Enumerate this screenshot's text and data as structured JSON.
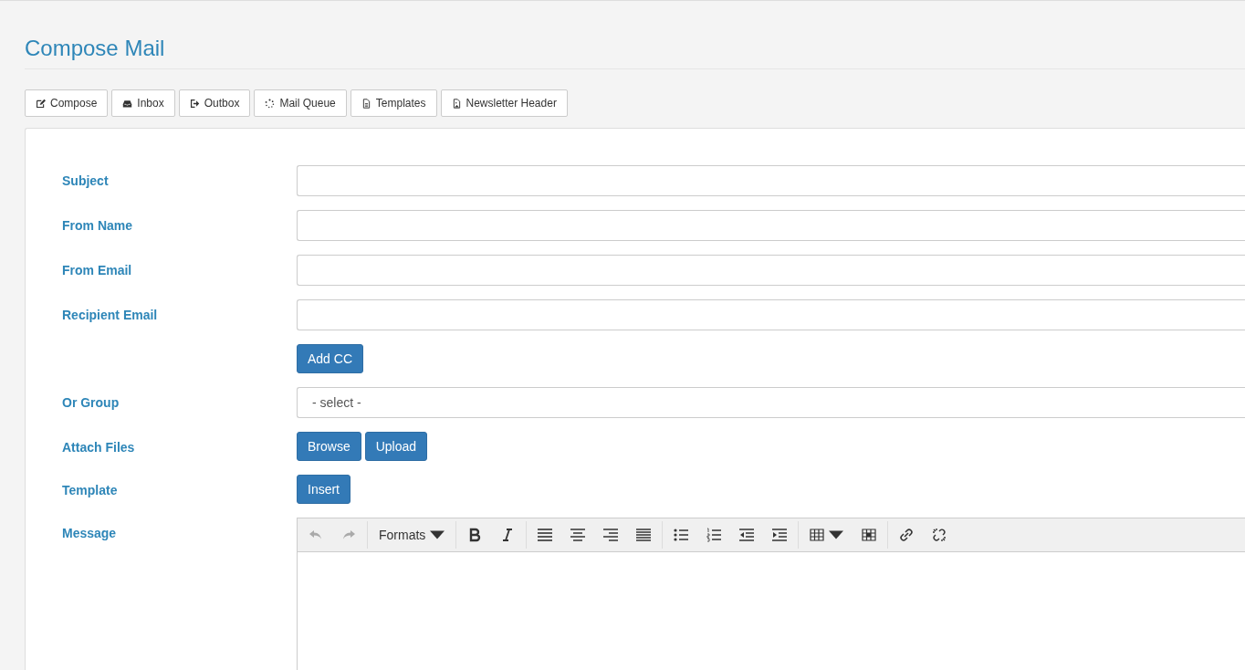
{
  "page_title": "Compose Mail",
  "nav": [
    {
      "label": "Compose"
    },
    {
      "label": "Inbox"
    },
    {
      "label": "Outbox"
    },
    {
      "label": "Mail Queue"
    },
    {
      "label": "Templates"
    },
    {
      "label": "Newsletter Header"
    }
  ],
  "form": [
    {
      "kind": "text",
      "label": "Subject"
    },
    {
      "kind": "text",
      "label": "From Name"
    },
    {
      "kind": "text",
      "label": "From Email"
    },
    {
      "kind": "text",
      "label": "Recipient Email"
    },
    {
      "kind": "buttons",
      "buttons": [
        "Add CC"
      ]
    },
    {
      "kind": "select",
      "label": "Or Group",
      "value": "- select -"
    },
    {
      "kind": "buttons",
      "label": "Attach Files",
      "buttons": [
        "Browse",
        "Upload"
      ]
    },
    {
      "kind": "buttons",
      "label": "Template",
      "buttons": [
        "Insert"
      ]
    },
    {
      "kind": "editor",
      "label": "Message"
    }
  ],
  "toolbar": [
    {
      "kind": "icon",
      "disabled": true
    },
    {
      "kind": "icon",
      "disabled": true
    },
    {
      "kind": "menu",
      "label": "Formats",
      "disabled": false
    },
    {
      "kind": "icon",
      "disabled": false
    },
    {
      "kind": "icon",
      "disabled": false
    },
    {
      "kind": "icon",
      "disabled": false
    },
    {
      "kind": "icon",
      "disabled": false
    },
    {
      "kind": "icon",
      "disabled": false
    },
    {
      "kind": "icon",
      "disabled": false
    },
    {
      "kind": "icon",
      "disabled": false
    },
    {
      "kind": "icon",
      "disabled": false
    },
    {
      "kind": "icon",
      "disabled": false
    },
    {
      "kind": "icon",
      "disabled": false
    },
    {
      "kind": "iconmenu",
      "disabled": false
    },
    {
      "kind": "icon",
      "disabled": false
    },
    {
      "kind": "icon",
      "disabled": false
    },
    {
      "kind": "icon",
      "disabled": false
    }
  ]
}
